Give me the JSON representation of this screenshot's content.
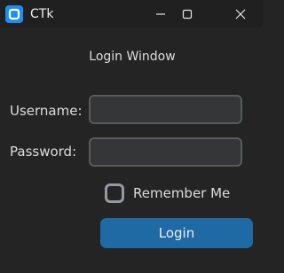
{
  "window": {
    "title": "CTk",
    "heading": "Login Window"
  },
  "icons": {
    "app": "ctk-app-icon",
    "minimize": "minimize-icon",
    "maximize": "maximize-icon",
    "close": "close-icon"
  },
  "form": {
    "username_label": "Username:",
    "username_value": "",
    "password_label": "Password:",
    "password_value": "",
    "remember_label": "Remember Me",
    "remember_checked": false,
    "login_label": "Login"
  },
  "colors": {
    "background": "#242424",
    "titlebar": "#202020",
    "entry_bg": "#343638",
    "entry_border": "#565b5e",
    "checkbox_border": "#949a9f",
    "accent": "#1f6aa5",
    "text": "#dcdcdc"
  }
}
